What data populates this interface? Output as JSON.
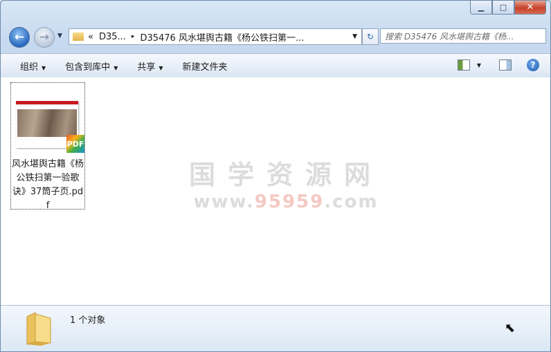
{
  "window": {
    "min_label": "▁",
    "max_label": "□",
    "close_label": "✕"
  },
  "nav": {
    "back_label": "←",
    "forward_label": "→",
    "history_dropdown": "▼",
    "address": {
      "overflow": "«",
      "crumb1": "D35...",
      "separator": "▸",
      "crumb2": "D35476 风水堪舆古籍《杨公铁扫第一...",
      "dropdown": "▼"
    },
    "refresh_label": "↻",
    "search_placeholder": "搜索 D35476 风水堪舆古籍《杨..."
  },
  "toolbar": {
    "organize": "组织",
    "include_library": "包含到库中",
    "share": "共享",
    "new_folder": "新建文件夹",
    "dropdown_arrow": "▼",
    "help": "?"
  },
  "file": {
    "name": "风水堪舆古籍《杨公铁扫第一验歌诀》37筒子页.pdf",
    "badge": "PDF",
    "thumb_header": "PDF"
  },
  "watermark": {
    "cn": "国学资源网",
    "url_prefix": "www.",
    "url_mid": "95959",
    "url_suffix": ".com"
  },
  "status": {
    "count_text": "1 个对象"
  },
  "colors": {
    "accent": "#2a69c1",
    "close": "#c7412a",
    "watermark": "#dcdcdc"
  }
}
